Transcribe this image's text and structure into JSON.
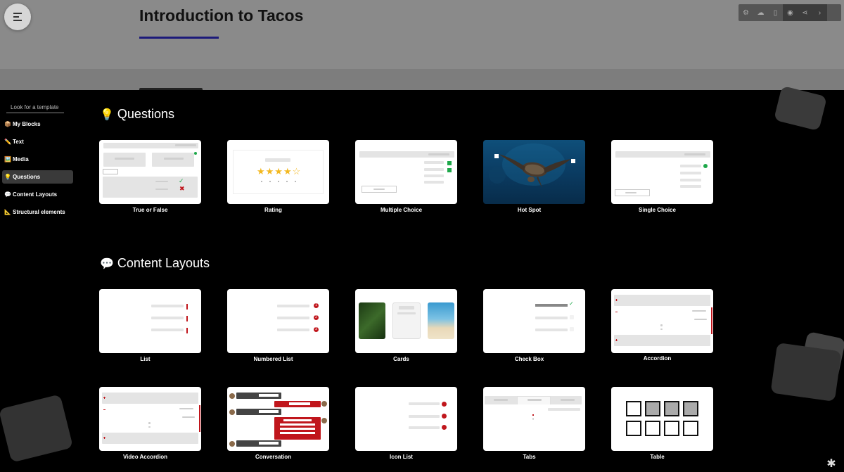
{
  "document": {
    "title": "Introduction to Tacos"
  },
  "toolbar": {
    "icons": [
      "settings-icon",
      "cloud-upload-icon",
      "book-icon",
      "eye-icon",
      "share-icon",
      "exit-icon"
    ]
  },
  "sidebar": {
    "search_placeholder": "Look for a template",
    "items": [
      {
        "emoji": "📦",
        "label": "My Blocks"
      },
      {
        "emoji": "✏️",
        "label": "Text"
      },
      {
        "emoji": "🖼️",
        "label": "Media"
      },
      {
        "emoji": "💡",
        "label": "Questions"
      },
      {
        "emoji": "💬",
        "label": "Content Layouts"
      },
      {
        "emoji": "📐",
        "label": "Structural elements"
      }
    ],
    "active_item": "Questions"
  },
  "sections": {
    "questions": {
      "emoji": "💡",
      "title": "Questions",
      "cards": [
        "True or False",
        "Rating",
        "Multiple Choice",
        "Hot Spot",
        "Single Choice"
      ]
    },
    "content_layouts": {
      "emoji": "💬",
      "title": "Content Layouts",
      "cards": [
        "List",
        "Numbered List",
        "Cards",
        "Check Box",
        "Accordion",
        "Video Accordion",
        "Conversation",
        "Icon List",
        "Tabs",
        "Table"
      ]
    }
  },
  "rating": {
    "stars": "★★★★☆"
  },
  "numbered_list": {
    "numbers": [
      "1",
      "2",
      "3"
    ]
  },
  "colors": {
    "accent_red": "#c0161c",
    "accent_green": "#1ea84a",
    "title_underline": "#1c1a7a",
    "star": "#f3b81f"
  }
}
